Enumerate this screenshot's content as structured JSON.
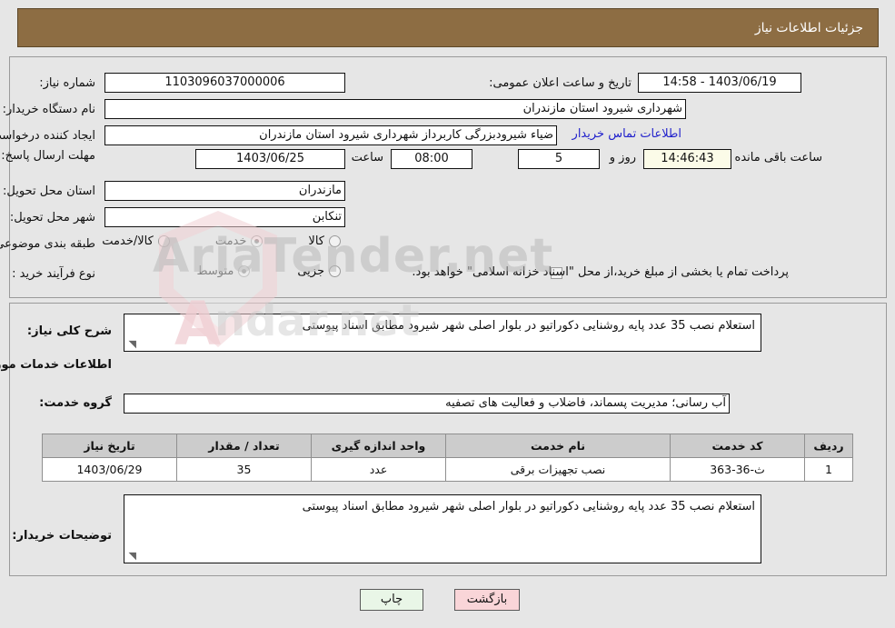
{
  "header": {
    "title": "جزئیات اطلاعات نیاز",
    "bg_color": "#8d6d43"
  },
  "watermark": {
    "text": "AriaTender.net",
    "mark": "A",
    "tail": "ndar.net"
  },
  "summary": {
    "need_number_label": "شماره نیاز:",
    "need_number_value": "1103096037000006",
    "announce_datetime_label": "تاریخ و ساعت اعلان عمومی:",
    "announce_datetime_value": "14:58 - 1403/06/19",
    "buyer_org_label": "نام دستگاه خریدار:",
    "buyer_org_value": "شهرداری شیرود استان مازندران",
    "requester_label": "ایجاد کننده درخواست:",
    "requester_value": "ضیاء شیرودبزرگی کاربرداز شهرداری شیرود استان مازندران",
    "buyer_contact_link": "اطلاعات تماس خریدار",
    "deadline_label": "مهلت ارسال پاسخ: تا تاریخ:",
    "deadline_date": "1403/06/25",
    "deadline_hour_label": "ساعت",
    "deadline_hour_value": "08:00",
    "remaining_days_value": "5",
    "remaining_days_label": "روز و",
    "remaining_time_value": "14:46:43",
    "remaining_time_label": "ساعت باقی مانده",
    "province_label": "استان محل تحویل:",
    "province_value": "مازندران",
    "city_label": "شهر محل تحویل:",
    "city_value": "تنکابن",
    "classification_label": "طبقه بندی موضوعی:",
    "classification_options": [
      {
        "label": "کالا",
        "selected": false
      },
      {
        "label": "خدمت",
        "selected": true
      },
      {
        "label": "کالا/خدمت",
        "selected": false
      }
    ],
    "process_label": "نوع فرآیند خرید :",
    "process_options": [
      {
        "label": "جزیی",
        "selected": false
      },
      {
        "label": "متوسط",
        "selected": true
      }
    ],
    "treasury_checkbox_checked": false,
    "treasury_text": "پرداخت تمام یا بخشی از مبلغ خرید،از محل \"اسناد خزانه اسلامی\" خواهد بود."
  },
  "details": {
    "general_desc_label": "شرح کلی نیاز:",
    "general_desc_value": "استعلام نصب 35 عدد پایه روشنایی دکوراتیو در بلوار اصلی شهر شیرود مطابق اسناد پیوستی",
    "services_section_title": "اطلاعات خدمات مورد نیاز",
    "service_group_label": "گروه خدمت:",
    "service_group_value": "آب رسانی؛ مدیریت پسماند، فاضلاب و فعالیت های تصفیه",
    "buyer_notes_label": "توضیحات خریدار:",
    "buyer_notes_value": "استعلام نصب 35 عدد پایه روشنایی دکوراتیو در بلوار اصلی شهر شیرود مطابق اسناد پیوستی"
  },
  "table": {
    "columns": [
      "ردیف",
      "کد خدمت",
      "نام خدمت",
      "واحد اندازه گیری",
      "تعداد / مقدار",
      "تاریخ نیاز"
    ],
    "rows": [
      {
        "row": "1",
        "code": "ث-36-363",
        "name": "نصب تجهیزات برقی",
        "unit": "عدد",
        "quantity": "35",
        "need_date": "1403/06/29"
      }
    ]
  },
  "footer": {
    "print_label": "چاپ",
    "back_label": "بازگشت"
  }
}
